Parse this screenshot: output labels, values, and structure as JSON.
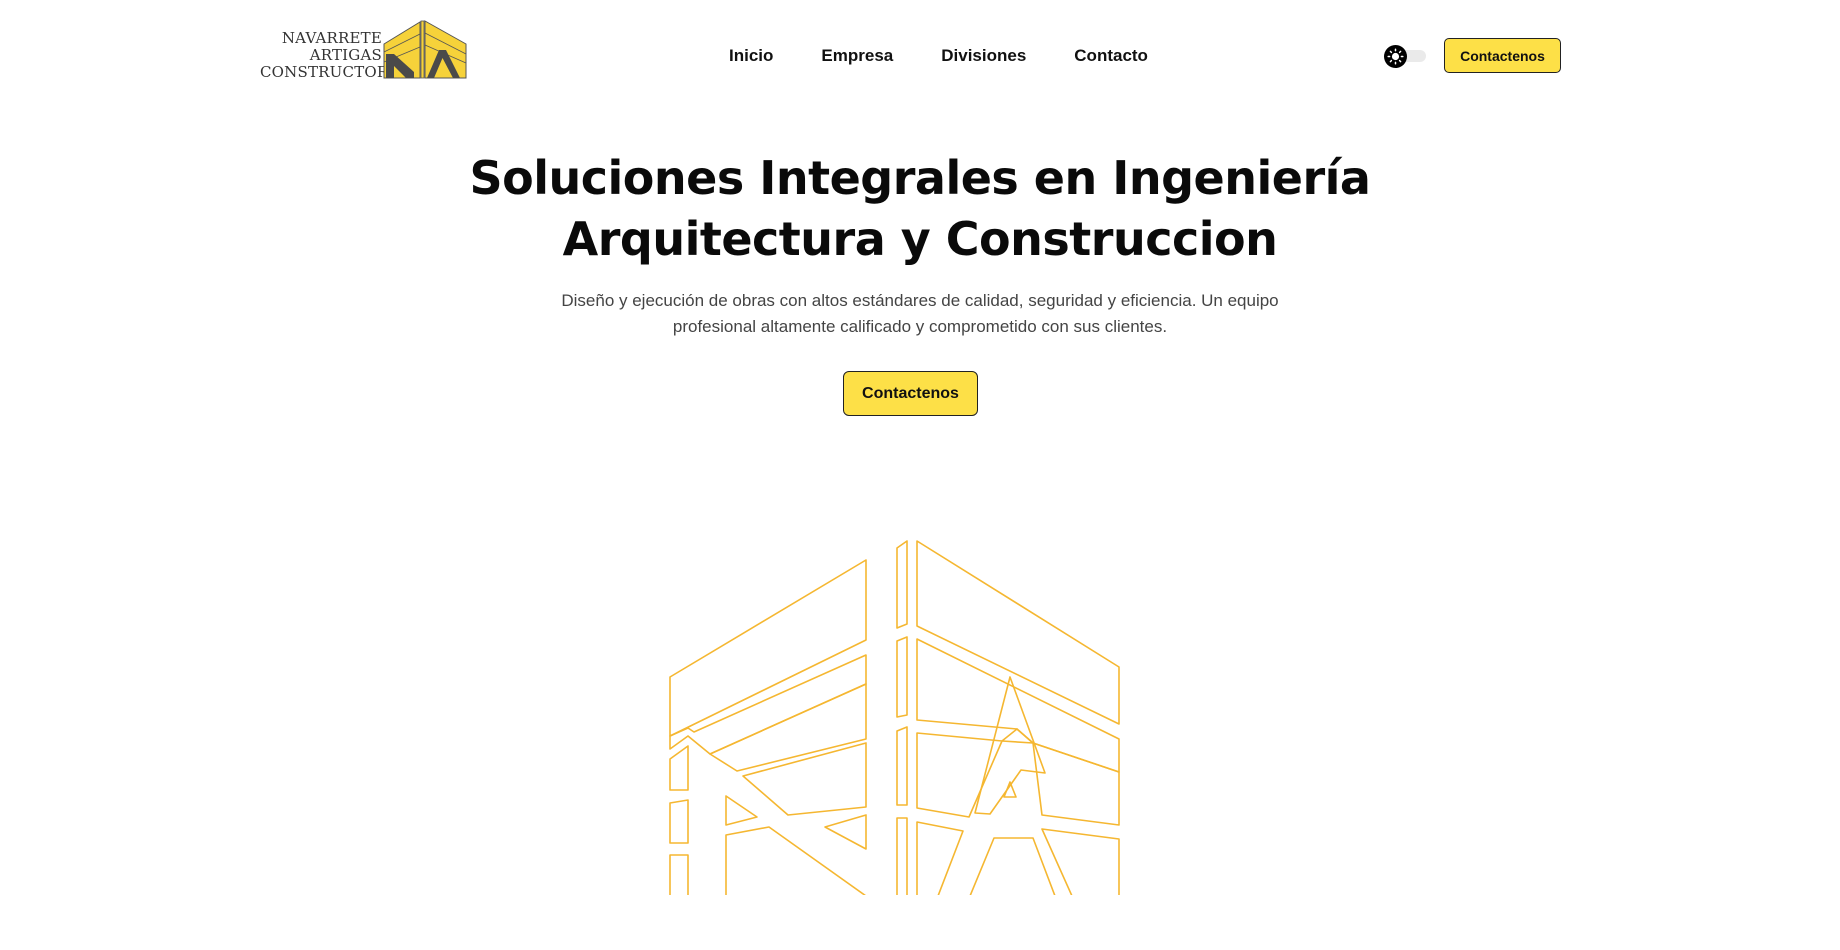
{
  "header": {
    "logo_lines": [
      "NAVARRETE",
      "ARTIGAS",
      "CONSTRUCTORA"
    ],
    "nav": [
      "Inicio",
      "Empresa",
      "Divisiones",
      "Contacto"
    ],
    "theme_toggle_icon": "sun-icon",
    "cta_label": "Contactenos"
  },
  "hero": {
    "title_line1": "Soluciones Integrales en Ingeniería",
    "title_line2": "Arquitectura y Construccion",
    "subtitle_line1": "Diseño y ejecución de obras con altos estándares de calidad, seguridad y eficiencia. Un equipo",
    "subtitle_line2": "profesional altamente calificado y comprometido con sus clientes.",
    "cta_label": "Contactenos",
    "illustration": "na-logo-outline"
  },
  "colors": {
    "accent": "#fde047",
    "logo_yellow": "#f6d23a",
    "logo_outline": "#f5b731",
    "text": "#0a0a0a"
  }
}
